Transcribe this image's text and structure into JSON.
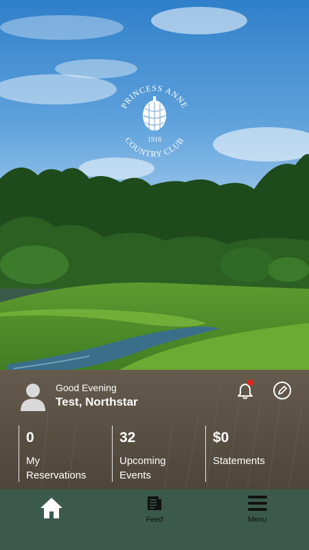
{
  "branding": {
    "club_name_top": "PRINCESS ANNE",
    "club_name_bottom": "COUNTRY CLUB",
    "year": "1916"
  },
  "user": {
    "greeting": "Good Evening",
    "name": "Test, Northstar",
    "avatar_icon": "person-avatar-icon"
  },
  "actions": {
    "notifications_icon": "bell-icon",
    "notification_dot_color": "#e6241c",
    "edit_icon": "pencil-circle-icon"
  },
  "stats": [
    {
      "value": "0",
      "label": "My Reservations"
    },
    {
      "value": "32",
      "label": "Upcoming Events"
    },
    {
      "value": "$0",
      "label": "Statements"
    }
  ],
  "tabs": {
    "home": {
      "label": "",
      "icon": "home-icon"
    },
    "feed": {
      "label": "Feed",
      "icon": "newspaper-icon"
    },
    "menu": {
      "label": "Menu",
      "icon": "hamburger-menu-icon"
    }
  },
  "colors": {
    "tabbar_background": "#3c5a4b",
    "text_on_panel": "#ffffff"
  }
}
